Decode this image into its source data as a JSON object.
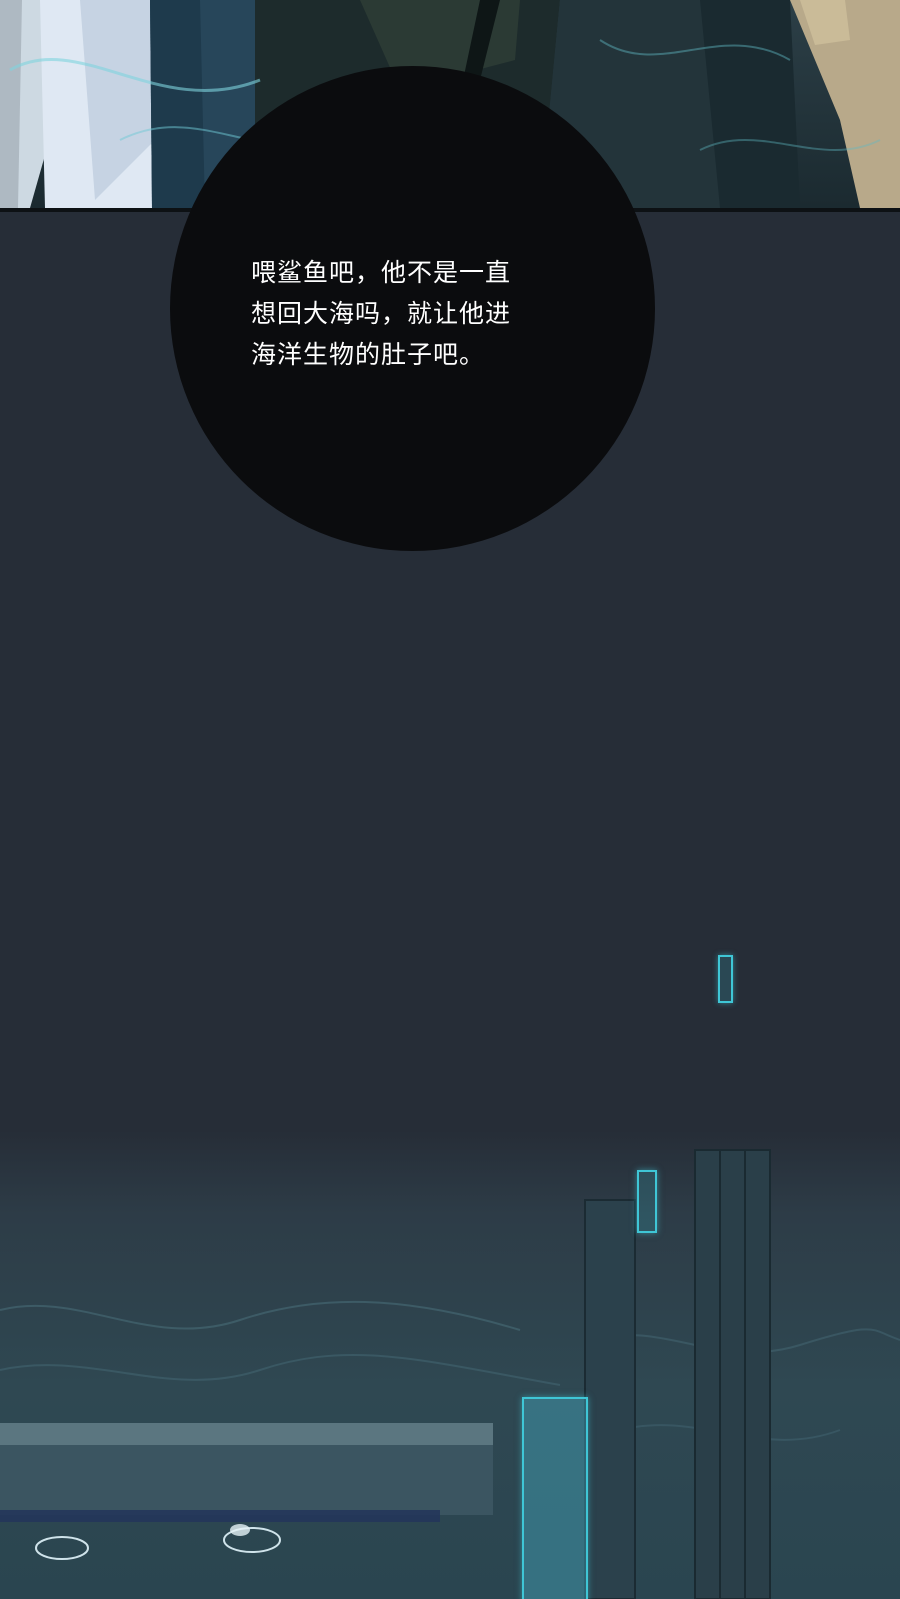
{
  "panels": {
    "top": {
      "description_icon": "figures-legs-icon"
    },
    "bottom": {
      "description_icon": "water-tank-icon"
    }
  },
  "speech": {
    "text": "喂鲨鱼吧，他不是一直\n想回大海吗，就让他进\n海洋生物的肚子吧。"
  },
  "colors": {
    "background": "#262d37",
    "bubble": "#0b0c0e",
    "text": "#ffffff",
    "glow": "#3fc6d6"
  }
}
